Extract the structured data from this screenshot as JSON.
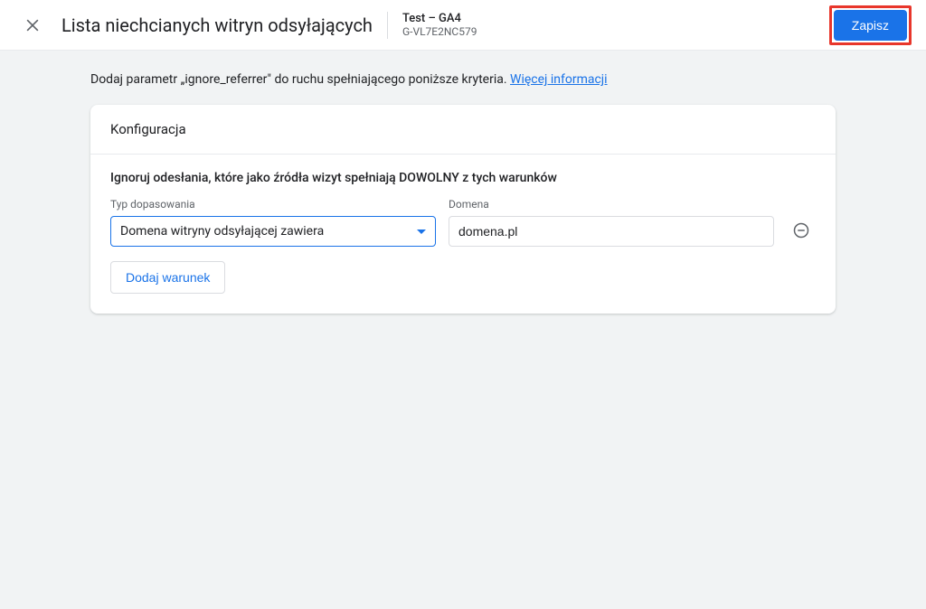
{
  "header": {
    "title": "Lista niechcianych witryn odsyłających",
    "property_name": "Test – GA4",
    "property_id": "G-VL7E2NC579",
    "save_label": "Zapisz"
  },
  "intro": {
    "text_prefix": "Dodaj parametr „ignore_referrer\" do ruchu spełniającego poniższe kryteria. ",
    "link_label": "Więcej informacji"
  },
  "card": {
    "title": "Konfiguracja",
    "subtitle": "Ignoruj odesłania, które jako źródła wizyt spełniają DOWOLNY z tych warunków",
    "match_label": "Typ dopasowania",
    "domain_label": "Domena",
    "conditions": [
      {
        "match_type": "Domena witryny odsyłającej zawiera",
        "domain": "domena.pl"
      }
    ],
    "add_label": "Dodaj warunek"
  }
}
